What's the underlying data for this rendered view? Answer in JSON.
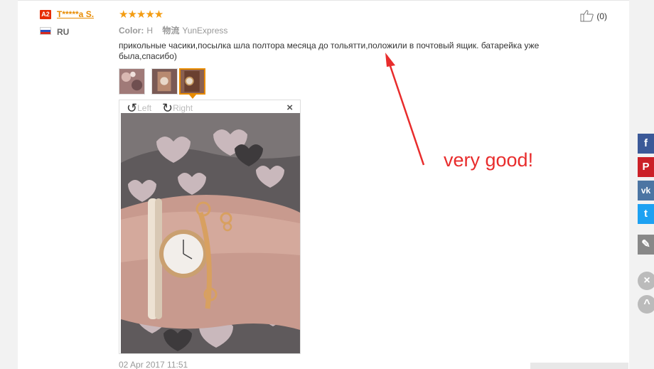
{
  "reviewer": {
    "level_badge": "A2",
    "name": "T*****a S.",
    "country": "RU"
  },
  "review": {
    "stars": "★★★★★",
    "color_label": "Color:",
    "color_value": "H",
    "shipping_label": "物流",
    "shipping_value": "YunExpress",
    "text": "прикольные часики,посылка шла полтора месяца до тольятти,положили в почтовый ящик. батарейка уже была,спасибо)",
    "date": "02 Apr 2017 11:51"
  },
  "helpful": {
    "count": "(0)"
  },
  "viewer": {
    "rotate_left": "Left",
    "rotate_right": "Right",
    "close": "×"
  },
  "annotation": {
    "text": "very good!"
  },
  "social": [
    {
      "name": "facebook",
      "glyph": "f",
      "color": "#3b5998"
    },
    {
      "name": "pinterest",
      "glyph": "P",
      "color": "#cb2027"
    },
    {
      "name": "vk",
      "glyph": "vk",
      "color": "#4c75a3"
    },
    {
      "name": "twitter",
      "glyph": "t",
      "color": "#1da1f2"
    },
    {
      "name": "edit",
      "glyph": "✎",
      "color": "#888888"
    }
  ],
  "controls": {
    "close_glyph": "×",
    "up_glyph": "^"
  }
}
